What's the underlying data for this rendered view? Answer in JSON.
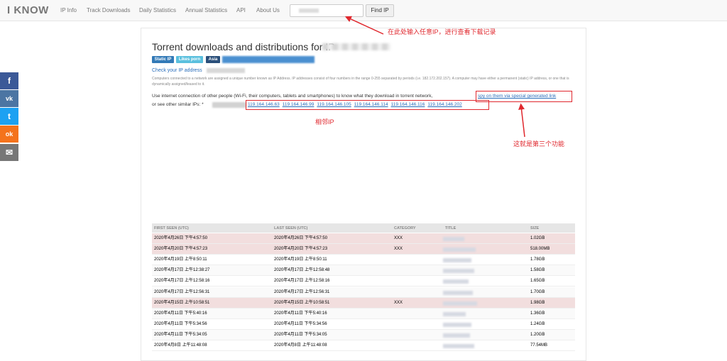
{
  "nav": {
    "brand": "I KNOW",
    "links": [
      "IP Info",
      "Track Downloads",
      "Daily Statistics",
      "Annual Statistics",
      "API",
      "About Us"
    ],
    "find_label": "Find IP"
  },
  "social": {
    "items": [
      {
        "icon": "facebook-icon",
        "glyph": "f",
        "color": "#3b5998"
      },
      {
        "icon": "vk-icon",
        "glyph": "vk",
        "color": "#4c75a3"
      },
      {
        "icon": "twitter-icon",
        "glyph": "t",
        "color": "#1da1f2"
      },
      {
        "icon": "odnoklassniki-icon",
        "glyph": "ok",
        "color": "#f4731c"
      },
      {
        "icon": "email-icon",
        "glyph": "✉",
        "color": "#777777"
      }
    ]
  },
  "main": {
    "title": "Torrent downloads and distributions for IP",
    "badges": [
      {
        "label": "Static IP",
        "color": "#337ab7"
      },
      {
        "label": "Likes porn",
        "color": "#5bc0de"
      },
      {
        "label": "Asia",
        "color": "#2a4f7a"
      }
    ],
    "check_ip_label": "Check your IP address",
    "description": "Computers connected to a network are assigned a unique number known as IP Address. IP addresses consist of four numbers in the range 0-255 separated by periods (i.e. 182.172.202.157). A computer may have either a permanent (static) IP address, or one that is dynamically assigned/leased to it.",
    "use_text": "Use internet connection of other people (Wi-Fi, their computers, tablets and smartphones) to know what they download in torrent network,",
    "spy_link": "spy on them via special generated link",
    "similar_label": "or see other similar IPs: *",
    "similar_ips": [
      "119.164.146.63",
      "119.164.146.99",
      "119.164.146.105",
      "119.164.146.114",
      "119.164.146.116",
      "119.164.146.202"
    ]
  },
  "annotations": {
    "search_note": "在此处输入任意IP，进行查看下载记录",
    "neighbor_note": "相邻IP",
    "third_feature_note": "这就是第三个功能",
    "color": "#e0282e"
  },
  "table": {
    "headers": [
      "FIRST SEEN (UTC)",
      "LAST SEEN (UTC)",
      "CATEGORY",
      "TITLE",
      "SIZE"
    ],
    "highlight_color": "#f2dede",
    "rows": [
      {
        "first": "2020年4月26日 下午4:57:50",
        "last": "2020年4月26日 下午4:57:50",
        "category": "XXX",
        "size": "1.02GB",
        "highlight": true
      },
      {
        "first": "2020年4月20日 下午4:57:23",
        "last": "2020年4月20日 下午4:57:23",
        "category": "XXX",
        "size": "518.00MB",
        "highlight": true
      },
      {
        "first": "2020年4月19日 上午8:50:11",
        "last": "2020年4月19日 上午8:50:11",
        "category": "",
        "size": "1.78GB",
        "highlight": false
      },
      {
        "first": "2020年4月17日 上午12:38:27",
        "last": "2020年4月17日 上午12:58:48",
        "category": "",
        "size": "1.58GB",
        "highlight": false
      },
      {
        "first": "2020年4月17日 上午12:58:16",
        "last": "2020年4月17日 上午12:58:16",
        "category": "",
        "size": "1.65GB",
        "highlight": false
      },
      {
        "first": "2020年4月17日 上午12:56:31",
        "last": "2020年4月17日 上午12:56:31",
        "category": "",
        "size": "1.70GB",
        "highlight": false
      },
      {
        "first": "2020年4月15日 上午10:58:51",
        "last": "2020年4月15日 上午10:58:51",
        "category": "XXX",
        "size": "1.98GB",
        "highlight": true
      },
      {
        "first": "2020年4月11日 下午5:40:16",
        "last": "2020年4月11日 下午5:40:16",
        "category": "",
        "size": "1.36GB",
        "highlight": false
      },
      {
        "first": "2020年4月11日 下午5:34:56",
        "last": "2020年4月11日 下午5:34:56",
        "category": "",
        "size": "1.24GB",
        "highlight": false
      },
      {
        "first": "2020年4月11日 下午5:34:05",
        "last": "2020年4月11日 下午5:34:05",
        "category": "",
        "size": "1.20GB",
        "highlight": false
      },
      {
        "first": "2020年4月8日 上午11:48:08",
        "last": "2020年4月8日 上午11:48:08",
        "category": "",
        "size": "77.54MB",
        "highlight": false
      }
    ]
  }
}
